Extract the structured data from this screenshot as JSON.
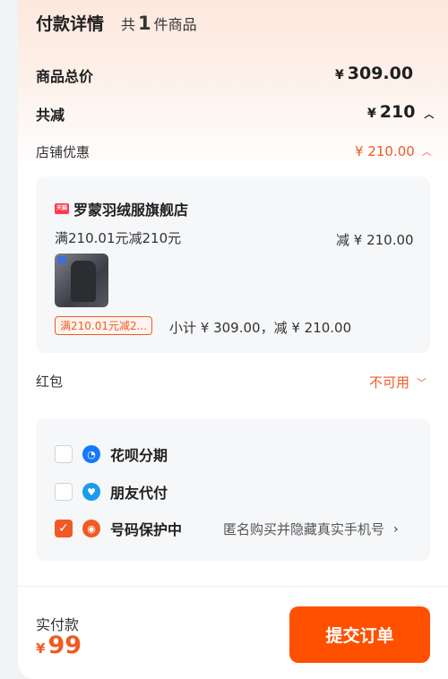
{
  "header": {
    "title": "付款详情",
    "count_prefix": "共",
    "count": "1",
    "count_suffix": "件商品"
  },
  "total": {
    "label": "商品总价",
    "currency": "¥",
    "value": "309.00"
  },
  "discount": {
    "label": "共减",
    "currency": "¥",
    "value": "210"
  },
  "shop_discount": {
    "label": "店铺优惠",
    "value": "¥ 210.00"
  },
  "shop": {
    "icon_text": "天猫",
    "name": "罗蒙羽绒服旗舰店",
    "rule": "满210.01元减210元",
    "rule_value": "减 ¥ 210.00",
    "promo_tag": "满210.01元减2...",
    "subtotal": "小计 ¥ 309.00，减 ¥ 210.00"
  },
  "red_packet": {
    "label": "红包",
    "value": "不可用"
  },
  "options": [
    {
      "label": "花呗分期",
      "checked": false,
      "icon": "huabei-icon",
      "color": "#1677ff"
    },
    {
      "label": "朋友代付",
      "checked": false,
      "icon": "friend-pay-icon",
      "color": "#1a9bf0"
    },
    {
      "label": "号码保护中",
      "checked": true,
      "icon": "shield-icon",
      "color": "#f05a24",
      "note": "匿名购买并隐藏真实手机号"
    }
  ],
  "footer": {
    "label": "实付款",
    "currency": "¥",
    "amount": "99",
    "submit": "提交订单"
  },
  "colors": {
    "accent": "#ff5000",
    "accent_text": "#f05a24"
  }
}
